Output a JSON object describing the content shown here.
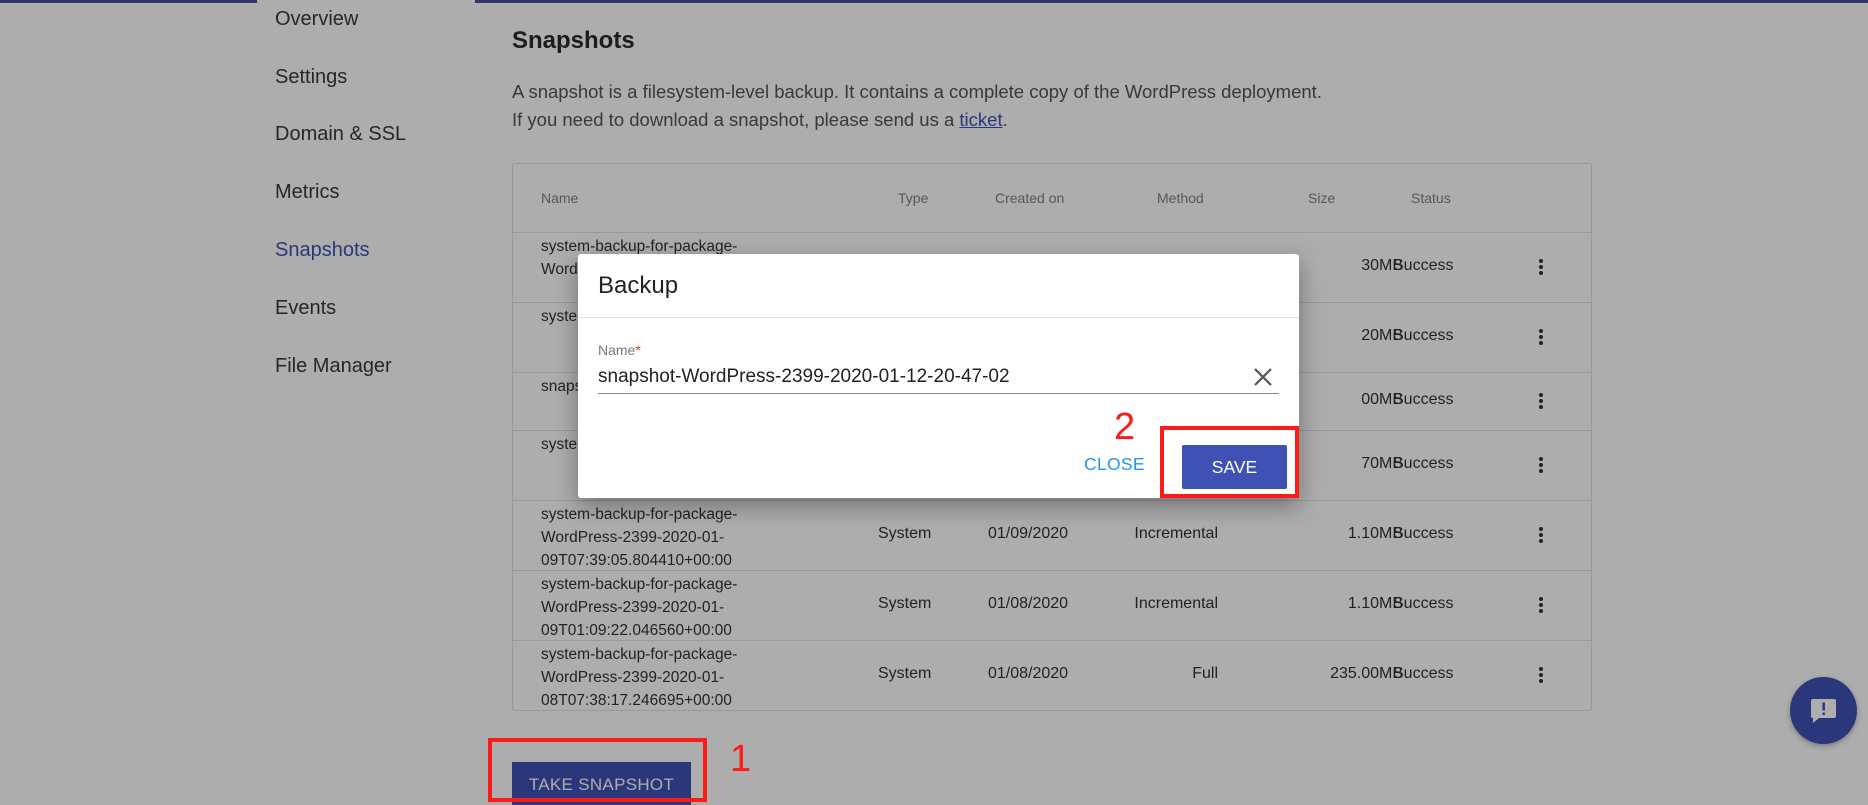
{
  "sidebar": {
    "items": [
      {
        "label": "Overview",
        "active": false
      },
      {
        "label": "Settings",
        "active": false
      },
      {
        "label": "Domain & SSL",
        "active": false
      },
      {
        "label": "Metrics",
        "active": false
      },
      {
        "label": "Snapshots",
        "active": true
      },
      {
        "label": "Events",
        "active": false
      },
      {
        "label": "File Manager",
        "active": false
      }
    ]
  },
  "main": {
    "title": "Snapshots",
    "description_line1": "A snapshot is a filesystem-level backup. It contains a complete copy of the WordPress deployment.",
    "description_line2_prefix": "If you need to download a snapshot, please send us a ",
    "description_line2_link": "ticket",
    "description_line2_suffix": "."
  },
  "table": {
    "headers": {
      "name": "Name",
      "type": "Type",
      "created_on": "Created on",
      "method": "Method",
      "size": "Size",
      "status": "Status"
    },
    "rows": [
      {
        "name": "system-backup-for-package-Word 12T0",
        "type": "",
        "created_on": "",
        "method": "",
        "size": "30MB",
        "status": "Success"
      },
      {
        "name": "syste Word 11T0",
        "type": "",
        "created_on": "",
        "method": "",
        "size": "20MB",
        "status": "Success"
      },
      {
        "name": "snaps 00-10",
        "type": "",
        "created_on": "",
        "method": "",
        "size": "00MB",
        "status": "Success"
      },
      {
        "name": "syste Word 10T0",
        "type": "",
        "created_on": "",
        "method": "",
        "size": "70MB",
        "status": "Success"
      },
      {
        "name": "system-backup-for-package-WordPress-2399-2020-01-09T07:39:05.804410+00:00",
        "type": "System",
        "created_on": "01/09/2020",
        "method": "Incremental",
        "size": "1.10MB",
        "status": "Success"
      },
      {
        "name": "system-backup-for-package-WordPress-2399-2020-01-09T01:09:22.046560+00:00",
        "type": "System",
        "created_on": "01/08/2020",
        "method": "Incremental",
        "size": "1.10MB",
        "status": "Success"
      },
      {
        "name": "system-backup-for-package-WordPress-2399-2020-01-08T07:38:17.246695+00:00",
        "type": "System",
        "created_on": "01/08/2020",
        "method": "Full",
        "size": "235.00MB",
        "status": "Success"
      }
    ]
  },
  "take_snapshot_label": "TAKE SNAPSHOT",
  "dialog": {
    "title": "Backup",
    "field_label": "Name",
    "field_required_mark": "*",
    "field_value": "snapshot-WordPress-2399-2020-01-12-20-47-02",
    "close_label": "CLOSE",
    "save_label": "SAVE"
  },
  "annotations": {
    "step1": "1",
    "step2": "2"
  },
  "colors": {
    "primary": "#3f51b5",
    "link": "#2196f3",
    "annotation": "#ff1a1a"
  }
}
